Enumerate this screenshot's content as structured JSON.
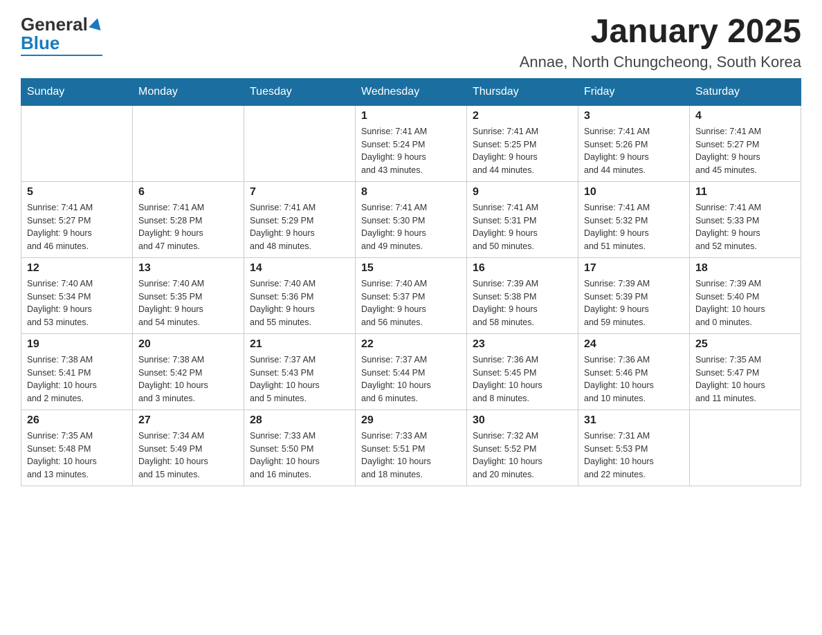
{
  "logo": {
    "text_general": "General",
    "text_blue": "Blue"
  },
  "title": "January 2025",
  "subtitle": "Annae, North Chungcheong, South Korea",
  "weekdays": [
    "Sunday",
    "Monday",
    "Tuesday",
    "Wednesday",
    "Thursday",
    "Friday",
    "Saturday"
  ],
  "weeks": [
    [
      {
        "day": "",
        "info": ""
      },
      {
        "day": "",
        "info": ""
      },
      {
        "day": "",
        "info": ""
      },
      {
        "day": "1",
        "info": "Sunrise: 7:41 AM\nSunset: 5:24 PM\nDaylight: 9 hours\nand 43 minutes."
      },
      {
        "day": "2",
        "info": "Sunrise: 7:41 AM\nSunset: 5:25 PM\nDaylight: 9 hours\nand 44 minutes."
      },
      {
        "day": "3",
        "info": "Sunrise: 7:41 AM\nSunset: 5:26 PM\nDaylight: 9 hours\nand 44 minutes."
      },
      {
        "day": "4",
        "info": "Sunrise: 7:41 AM\nSunset: 5:27 PM\nDaylight: 9 hours\nand 45 minutes."
      }
    ],
    [
      {
        "day": "5",
        "info": "Sunrise: 7:41 AM\nSunset: 5:27 PM\nDaylight: 9 hours\nand 46 minutes."
      },
      {
        "day": "6",
        "info": "Sunrise: 7:41 AM\nSunset: 5:28 PM\nDaylight: 9 hours\nand 47 minutes."
      },
      {
        "day": "7",
        "info": "Sunrise: 7:41 AM\nSunset: 5:29 PM\nDaylight: 9 hours\nand 48 minutes."
      },
      {
        "day": "8",
        "info": "Sunrise: 7:41 AM\nSunset: 5:30 PM\nDaylight: 9 hours\nand 49 minutes."
      },
      {
        "day": "9",
        "info": "Sunrise: 7:41 AM\nSunset: 5:31 PM\nDaylight: 9 hours\nand 50 minutes."
      },
      {
        "day": "10",
        "info": "Sunrise: 7:41 AM\nSunset: 5:32 PM\nDaylight: 9 hours\nand 51 minutes."
      },
      {
        "day": "11",
        "info": "Sunrise: 7:41 AM\nSunset: 5:33 PM\nDaylight: 9 hours\nand 52 minutes."
      }
    ],
    [
      {
        "day": "12",
        "info": "Sunrise: 7:40 AM\nSunset: 5:34 PM\nDaylight: 9 hours\nand 53 minutes."
      },
      {
        "day": "13",
        "info": "Sunrise: 7:40 AM\nSunset: 5:35 PM\nDaylight: 9 hours\nand 54 minutes."
      },
      {
        "day": "14",
        "info": "Sunrise: 7:40 AM\nSunset: 5:36 PM\nDaylight: 9 hours\nand 55 minutes."
      },
      {
        "day": "15",
        "info": "Sunrise: 7:40 AM\nSunset: 5:37 PM\nDaylight: 9 hours\nand 56 minutes."
      },
      {
        "day": "16",
        "info": "Sunrise: 7:39 AM\nSunset: 5:38 PM\nDaylight: 9 hours\nand 58 minutes."
      },
      {
        "day": "17",
        "info": "Sunrise: 7:39 AM\nSunset: 5:39 PM\nDaylight: 9 hours\nand 59 minutes."
      },
      {
        "day": "18",
        "info": "Sunrise: 7:39 AM\nSunset: 5:40 PM\nDaylight: 10 hours\nand 0 minutes."
      }
    ],
    [
      {
        "day": "19",
        "info": "Sunrise: 7:38 AM\nSunset: 5:41 PM\nDaylight: 10 hours\nand 2 minutes."
      },
      {
        "day": "20",
        "info": "Sunrise: 7:38 AM\nSunset: 5:42 PM\nDaylight: 10 hours\nand 3 minutes."
      },
      {
        "day": "21",
        "info": "Sunrise: 7:37 AM\nSunset: 5:43 PM\nDaylight: 10 hours\nand 5 minutes."
      },
      {
        "day": "22",
        "info": "Sunrise: 7:37 AM\nSunset: 5:44 PM\nDaylight: 10 hours\nand 6 minutes."
      },
      {
        "day": "23",
        "info": "Sunrise: 7:36 AM\nSunset: 5:45 PM\nDaylight: 10 hours\nand 8 minutes."
      },
      {
        "day": "24",
        "info": "Sunrise: 7:36 AM\nSunset: 5:46 PM\nDaylight: 10 hours\nand 10 minutes."
      },
      {
        "day": "25",
        "info": "Sunrise: 7:35 AM\nSunset: 5:47 PM\nDaylight: 10 hours\nand 11 minutes."
      }
    ],
    [
      {
        "day": "26",
        "info": "Sunrise: 7:35 AM\nSunset: 5:48 PM\nDaylight: 10 hours\nand 13 minutes."
      },
      {
        "day": "27",
        "info": "Sunrise: 7:34 AM\nSunset: 5:49 PM\nDaylight: 10 hours\nand 15 minutes."
      },
      {
        "day": "28",
        "info": "Sunrise: 7:33 AM\nSunset: 5:50 PM\nDaylight: 10 hours\nand 16 minutes."
      },
      {
        "day": "29",
        "info": "Sunrise: 7:33 AM\nSunset: 5:51 PM\nDaylight: 10 hours\nand 18 minutes."
      },
      {
        "day": "30",
        "info": "Sunrise: 7:32 AM\nSunset: 5:52 PM\nDaylight: 10 hours\nand 20 minutes."
      },
      {
        "day": "31",
        "info": "Sunrise: 7:31 AM\nSunset: 5:53 PM\nDaylight: 10 hours\nand 22 minutes."
      },
      {
        "day": "",
        "info": ""
      }
    ]
  ]
}
